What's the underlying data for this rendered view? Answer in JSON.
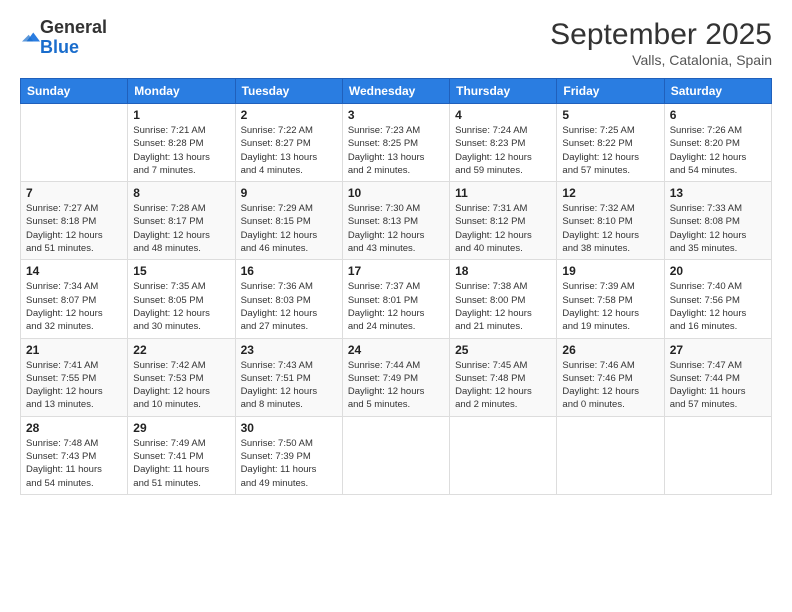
{
  "logo": {
    "general": "General",
    "blue": "Blue"
  },
  "header": {
    "month": "September 2025",
    "location": "Valls, Catalonia, Spain"
  },
  "days_of_week": [
    "Sunday",
    "Monday",
    "Tuesday",
    "Wednesday",
    "Thursday",
    "Friday",
    "Saturday"
  ],
  "weeks": [
    [
      {
        "day": "",
        "info": ""
      },
      {
        "day": "1",
        "info": "Sunrise: 7:21 AM\nSunset: 8:28 PM\nDaylight: 13 hours\nand 7 minutes."
      },
      {
        "day": "2",
        "info": "Sunrise: 7:22 AM\nSunset: 8:27 PM\nDaylight: 13 hours\nand 4 minutes."
      },
      {
        "day": "3",
        "info": "Sunrise: 7:23 AM\nSunset: 8:25 PM\nDaylight: 13 hours\nand 2 minutes."
      },
      {
        "day": "4",
        "info": "Sunrise: 7:24 AM\nSunset: 8:23 PM\nDaylight: 12 hours\nand 59 minutes."
      },
      {
        "day": "5",
        "info": "Sunrise: 7:25 AM\nSunset: 8:22 PM\nDaylight: 12 hours\nand 57 minutes."
      },
      {
        "day": "6",
        "info": "Sunrise: 7:26 AM\nSunset: 8:20 PM\nDaylight: 12 hours\nand 54 minutes."
      }
    ],
    [
      {
        "day": "7",
        "info": "Sunrise: 7:27 AM\nSunset: 8:18 PM\nDaylight: 12 hours\nand 51 minutes."
      },
      {
        "day": "8",
        "info": "Sunrise: 7:28 AM\nSunset: 8:17 PM\nDaylight: 12 hours\nand 48 minutes."
      },
      {
        "day": "9",
        "info": "Sunrise: 7:29 AM\nSunset: 8:15 PM\nDaylight: 12 hours\nand 46 minutes."
      },
      {
        "day": "10",
        "info": "Sunrise: 7:30 AM\nSunset: 8:13 PM\nDaylight: 12 hours\nand 43 minutes."
      },
      {
        "day": "11",
        "info": "Sunrise: 7:31 AM\nSunset: 8:12 PM\nDaylight: 12 hours\nand 40 minutes."
      },
      {
        "day": "12",
        "info": "Sunrise: 7:32 AM\nSunset: 8:10 PM\nDaylight: 12 hours\nand 38 minutes."
      },
      {
        "day": "13",
        "info": "Sunrise: 7:33 AM\nSunset: 8:08 PM\nDaylight: 12 hours\nand 35 minutes."
      }
    ],
    [
      {
        "day": "14",
        "info": "Sunrise: 7:34 AM\nSunset: 8:07 PM\nDaylight: 12 hours\nand 32 minutes."
      },
      {
        "day": "15",
        "info": "Sunrise: 7:35 AM\nSunset: 8:05 PM\nDaylight: 12 hours\nand 30 minutes."
      },
      {
        "day": "16",
        "info": "Sunrise: 7:36 AM\nSunset: 8:03 PM\nDaylight: 12 hours\nand 27 minutes."
      },
      {
        "day": "17",
        "info": "Sunrise: 7:37 AM\nSunset: 8:01 PM\nDaylight: 12 hours\nand 24 minutes."
      },
      {
        "day": "18",
        "info": "Sunrise: 7:38 AM\nSunset: 8:00 PM\nDaylight: 12 hours\nand 21 minutes."
      },
      {
        "day": "19",
        "info": "Sunrise: 7:39 AM\nSunset: 7:58 PM\nDaylight: 12 hours\nand 19 minutes."
      },
      {
        "day": "20",
        "info": "Sunrise: 7:40 AM\nSunset: 7:56 PM\nDaylight: 12 hours\nand 16 minutes."
      }
    ],
    [
      {
        "day": "21",
        "info": "Sunrise: 7:41 AM\nSunset: 7:55 PM\nDaylight: 12 hours\nand 13 minutes."
      },
      {
        "day": "22",
        "info": "Sunrise: 7:42 AM\nSunset: 7:53 PM\nDaylight: 12 hours\nand 10 minutes."
      },
      {
        "day": "23",
        "info": "Sunrise: 7:43 AM\nSunset: 7:51 PM\nDaylight: 12 hours\nand 8 minutes."
      },
      {
        "day": "24",
        "info": "Sunrise: 7:44 AM\nSunset: 7:49 PM\nDaylight: 12 hours\nand 5 minutes."
      },
      {
        "day": "25",
        "info": "Sunrise: 7:45 AM\nSunset: 7:48 PM\nDaylight: 12 hours\nand 2 minutes."
      },
      {
        "day": "26",
        "info": "Sunrise: 7:46 AM\nSunset: 7:46 PM\nDaylight: 12 hours\nand 0 minutes."
      },
      {
        "day": "27",
        "info": "Sunrise: 7:47 AM\nSunset: 7:44 PM\nDaylight: 11 hours\nand 57 minutes."
      }
    ],
    [
      {
        "day": "28",
        "info": "Sunrise: 7:48 AM\nSunset: 7:43 PM\nDaylight: 11 hours\nand 54 minutes."
      },
      {
        "day": "29",
        "info": "Sunrise: 7:49 AM\nSunset: 7:41 PM\nDaylight: 11 hours\nand 51 minutes."
      },
      {
        "day": "30",
        "info": "Sunrise: 7:50 AM\nSunset: 7:39 PM\nDaylight: 11 hours\nand 49 minutes."
      },
      {
        "day": "",
        "info": ""
      },
      {
        "day": "",
        "info": ""
      },
      {
        "day": "",
        "info": ""
      },
      {
        "day": "",
        "info": ""
      }
    ]
  ]
}
